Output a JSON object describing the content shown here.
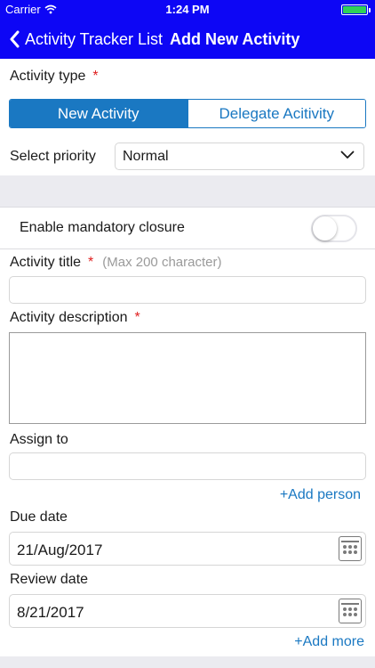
{
  "status_bar": {
    "carrier": "Carrier",
    "time": "1:24 PM"
  },
  "nav": {
    "back_label": "Activity Tracker List",
    "title": "Add New Activity"
  },
  "activity_type": {
    "label": "Activity type",
    "required_mark": "*",
    "segments": [
      "New Activity",
      "Delegate Acitivity"
    ],
    "selected": "New Activity"
  },
  "priority": {
    "label": "Select priority",
    "value": "Normal"
  },
  "mandatory_closure": {
    "label": "Enable mandatory closure",
    "enabled": false
  },
  "activity_title": {
    "label": "Activity title",
    "required_mark": "*",
    "hint": "(Max 200 character)",
    "value": ""
  },
  "activity_description": {
    "label": "Activity description",
    "required_mark": "*",
    "value": ""
  },
  "assign_to": {
    "label": "Assign to",
    "value": "",
    "add_link": "+Add person"
  },
  "due_date": {
    "label": "Due date",
    "value": "21/Aug/2017"
  },
  "review_date": {
    "label": "Review date",
    "value": "8/21/2017",
    "add_link": "+Add more"
  },
  "icons": [
    "back-chevron-icon",
    "wifi-icon",
    "battery-icon",
    "dropdown-chevron-icon",
    "calendar-icon"
  ],
  "colors": {
    "nav_bar": "#0d06f5",
    "accent": "#1a78c2",
    "required": "#e02020",
    "battery": "#2fd158"
  }
}
